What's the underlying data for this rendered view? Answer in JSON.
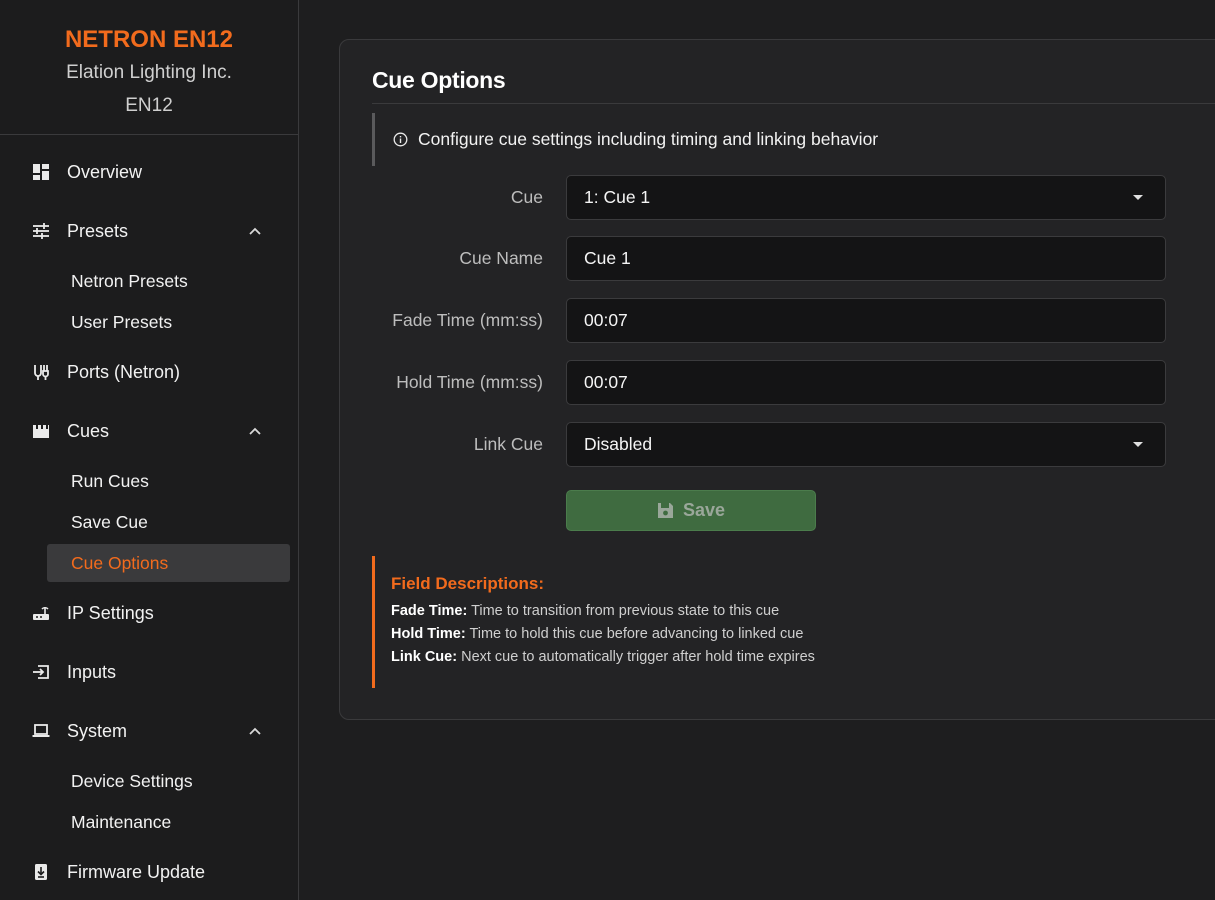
{
  "brand": {
    "title": "NETRON EN12",
    "company": "Elation Lighting Inc.",
    "model": "EN12"
  },
  "sidebar": {
    "items": [
      {
        "label": "Overview",
        "icon": "dashboard-icon"
      },
      {
        "label": "Presets",
        "icon": "sliders-icon",
        "expanded": true,
        "children": [
          "Netron Presets",
          "User Presets"
        ]
      },
      {
        "label": "Ports (Netron)",
        "icon": "ports-icon"
      },
      {
        "label": "Cues",
        "icon": "clapperboard-icon",
        "expanded": true,
        "children": [
          "Run Cues",
          "Save Cue",
          "Cue Options"
        ]
      },
      {
        "label": "IP Settings",
        "icon": "router-icon"
      },
      {
        "label": "Inputs",
        "icon": "input-icon"
      },
      {
        "label": "System",
        "icon": "laptop-icon",
        "expanded": true,
        "children": [
          "Device Settings",
          "Maintenance"
        ]
      },
      {
        "label": "Firmware Update",
        "icon": "firmware-icon"
      }
    ],
    "active": "Cue Options"
  },
  "main": {
    "title": "Cue Options",
    "info": "Configure cue settings including timing and linking behavior",
    "form": {
      "cue_label": "Cue",
      "cue_value": "1: Cue 1",
      "name_label": "Cue Name",
      "name_value": "Cue 1",
      "fade_label": "Fade Time (mm:ss)",
      "fade_value": "00:07",
      "hold_label": "Hold Time (mm:ss)",
      "hold_value": "00:07",
      "link_label": "Link Cue",
      "link_value": "Disabled"
    },
    "save_label": "Save",
    "descriptions": {
      "title": "Field Descriptions:",
      "fade_term": "Fade Time:",
      "fade_text": "Time to transition from previous state to this cue",
      "hold_term": "Hold Time:",
      "hold_text": "Time to hold this cue before advancing to linked cue",
      "link_term": "Link Cue:",
      "link_text": "Next cue to automatically trigger after hold time expires"
    }
  },
  "colors": {
    "accent": "#f26b1d",
    "save_button": "#3f6b40",
    "background": "#1e1e1f",
    "card": "#232325"
  }
}
